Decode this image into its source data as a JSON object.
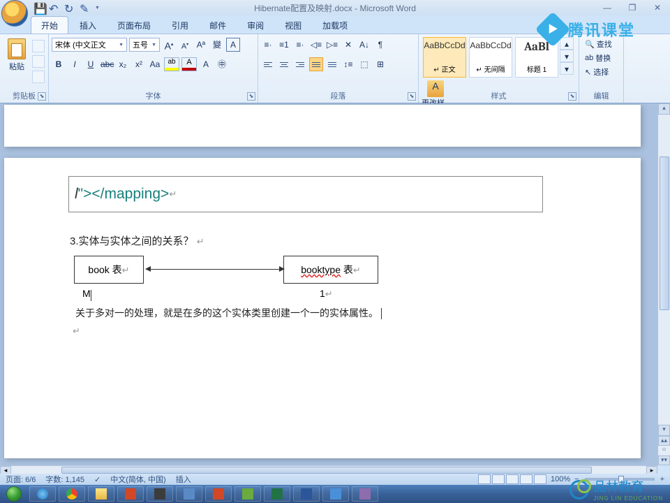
{
  "title": "Hibernate配置及映射.docx - Microsoft Word",
  "window_controls": {
    "min": "—",
    "restore": "❐",
    "close": "✕"
  },
  "menu": {
    "tabs": [
      "开始",
      "插入",
      "页面布局",
      "引用",
      "邮件",
      "审阅",
      "视图",
      "加载项"
    ],
    "active": 0
  },
  "ribbon": {
    "clipboard": {
      "label": "剪贴板",
      "paste": "粘贴"
    },
    "font": {
      "label": "字体",
      "name": "宋体 (中文正文",
      "size": "五号",
      "bold": "B",
      "italic": "I",
      "underline": "U",
      "strike": "abc",
      "sub": "x₂",
      "sup": "x²",
      "case": "Aa",
      "grow": "A",
      "shrink": "A",
      "clear": "A"
    },
    "paragraph": {
      "label": "段落"
    },
    "styles": {
      "label": "样式",
      "cards": [
        {
          "preview": "AaBbCcDd",
          "name": "↵ 正文"
        },
        {
          "preview": "AaBbCcDd",
          "name": "↵ 无间隔"
        },
        {
          "preview": "AaBl",
          "name": "标题 1"
        }
      ],
      "change": "更改样式"
    },
    "editing": {
      "label": "编辑",
      "find": "查找",
      "replace": "替换",
      "select": "选择"
    }
  },
  "document": {
    "code_fragment": {
      "italic": "l",
      "xml": "\"></mapping>"
    },
    "heading": "3.实体与实体之间的关系？",
    "box1": "book 表",
    "box2_a": "booktype",
    "box2_b": " 表",
    "label_m": "M",
    "label_1": "1",
    "body": "关于多对一的处理，就是在多的这个实体类里创建一个一的实体属性。"
  },
  "status": {
    "page": "页面: 6/6",
    "words": "字数: 1,145",
    "lang": "中文(简体, 中国)",
    "mode": "插入",
    "zoom": "100%",
    "minus": "−",
    "plus": "+"
  },
  "watermark": {
    "top": "腾讯课堂",
    "bottom": "品林教育",
    "bottom_en": "JING LIN EDUCATION"
  }
}
